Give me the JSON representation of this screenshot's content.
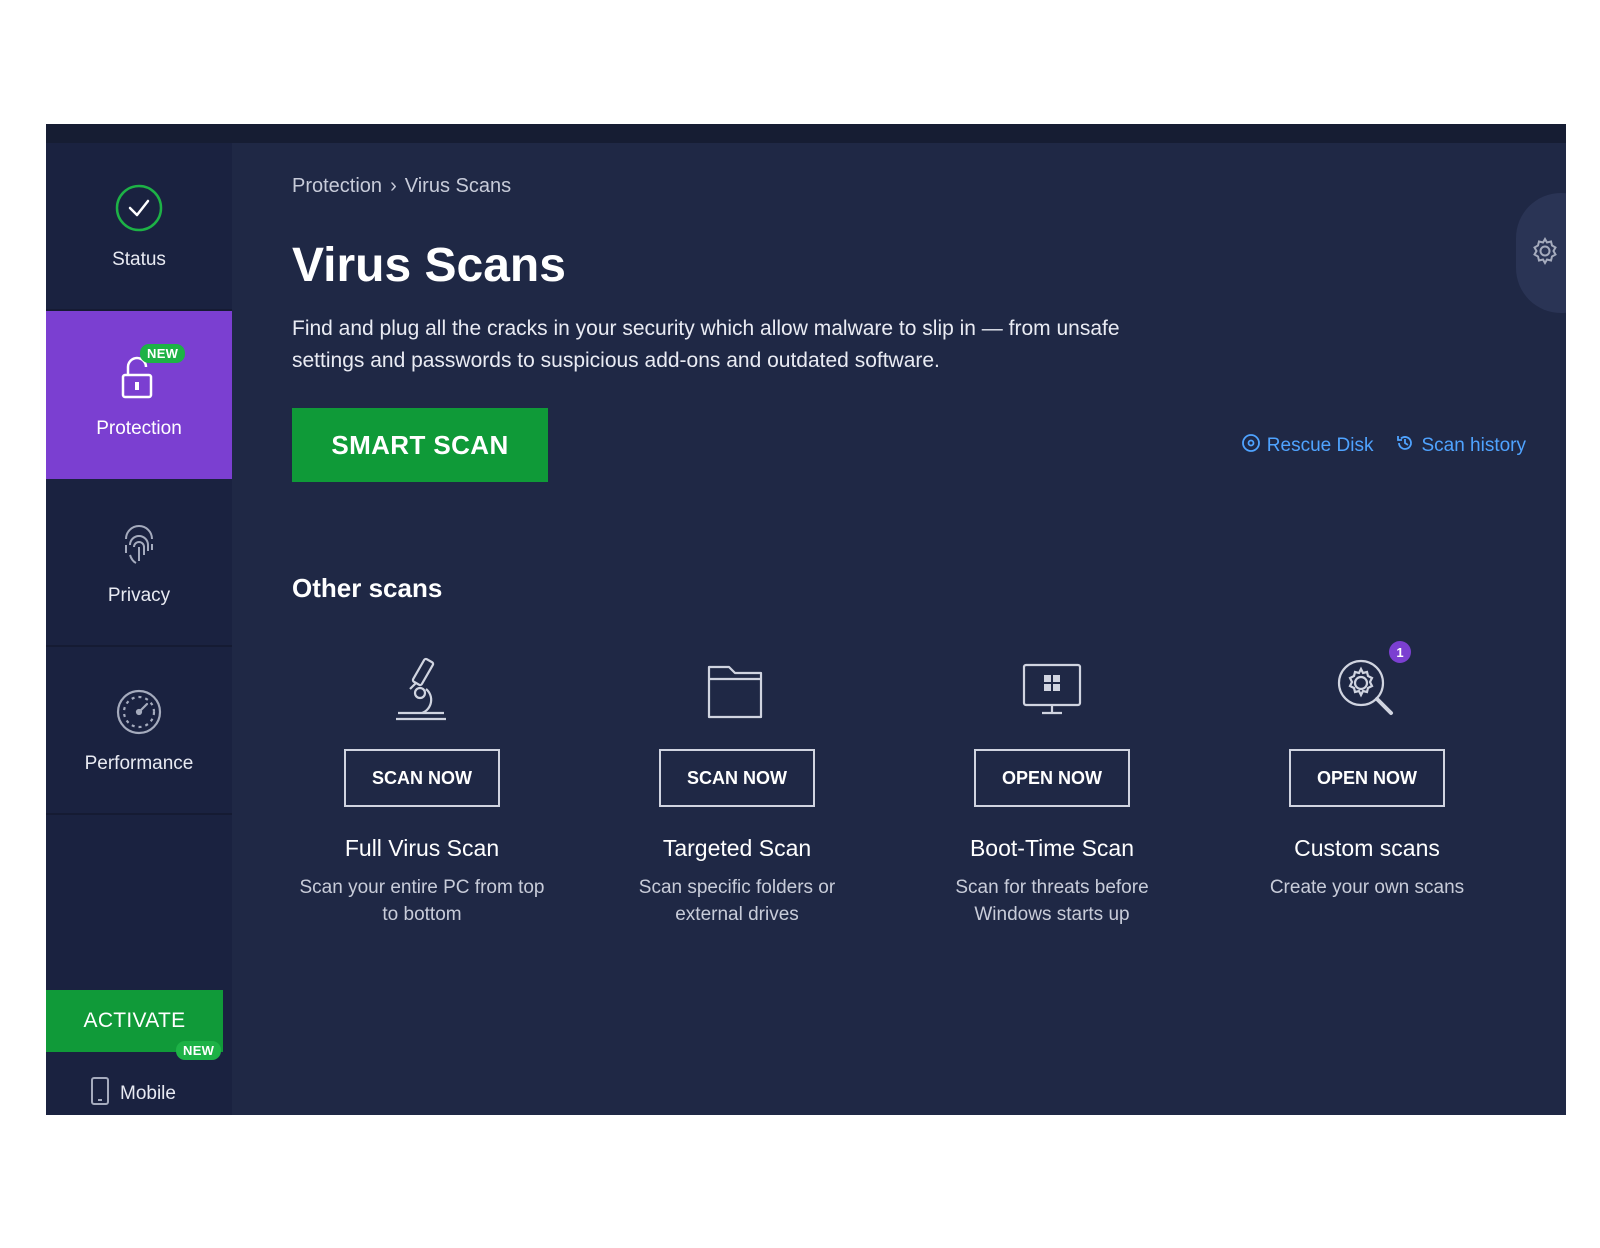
{
  "sidebar": {
    "items": [
      {
        "label": "Status",
        "icon": "check-circle-icon"
      },
      {
        "label": "Protection",
        "icon": "lock-icon",
        "badge": "NEW"
      },
      {
        "label": "Privacy",
        "icon": "fingerprint-icon"
      },
      {
        "label": "Performance",
        "icon": "speedometer-icon"
      }
    ],
    "activate_label": "ACTIVATE",
    "mobile": {
      "label": "Mobile",
      "badge": "NEW",
      "icon": "phone-icon"
    }
  },
  "header": {
    "breadcrumb": [
      "Protection",
      "›",
      "Virus Scans"
    ],
    "title": "Virus Scans",
    "description": "Find and plug all the cracks in your security which allow malware to slip in — from unsafe settings and passwords to suspicious add-ons and outdated software."
  },
  "actions": {
    "smart_scan_label": "SMART SCAN",
    "rescue_disk_label": "Rescue Disk",
    "scan_history_label": "Scan history",
    "settings_icon": "gear-icon"
  },
  "other_scans": {
    "title": "Other scans",
    "cards": [
      {
        "button": "SCAN NOW",
        "name": "Full Virus Scan",
        "desc": "Scan your entire PC from top to bottom",
        "icon": "microscope-icon"
      },
      {
        "button": "SCAN NOW",
        "name": "Targeted Scan",
        "desc": "Scan specific folders or external drives",
        "icon": "folder-icon"
      },
      {
        "button": "OPEN NOW",
        "name": "Boot-Time Scan",
        "desc": "Scan for threats before Windows starts up",
        "icon": "monitor-icon"
      },
      {
        "button": "OPEN NOW",
        "name": "Custom scans",
        "desc": "Create your own scans",
        "icon": "search-gear-icon",
        "badge": "1"
      }
    ]
  },
  "colors": {
    "background": "#1f2845",
    "sidebar": "#1a2240",
    "active_nav": "#7b3fd1",
    "green": "#0f9a38",
    "link": "#4fa3ff"
  }
}
